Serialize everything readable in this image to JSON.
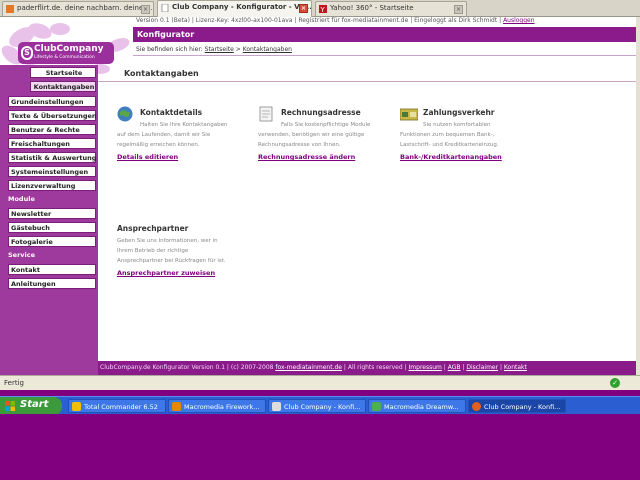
{
  "browser": {
    "tabs": [
      {
        "label": "paderflirt.de. deine nachbarn. deine F...",
        "active": false
      },
      {
        "label": "Club Company - Konfigurator - Ve...",
        "active": true
      },
      {
        "label": "Yahoo! 360° - Startseite",
        "active": false
      }
    ],
    "status_text": "Fertig"
  },
  "header": {
    "meta_text": "Version 0.1 (Beta) | Lizenz-Key: 4xzl00-ax100-01ava | Registriert für fox-mediatainment.de | Eingeloggt als Dirk Schmidt |",
    "logout_label": "Ausloggen",
    "section_title": "Konfigurator",
    "breadcrumb_prefix": "Sie befinden sich hier:",
    "breadcrumb_home": "Startseite",
    "breadcrumb_sep": ">",
    "breadcrumb_current": "Kontaktangaben"
  },
  "logo": {
    "name": "ClubCompany",
    "tagline": "Lifestyle & Communication",
    "mark": "S"
  },
  "sidebar": {
    "top_items": [
      {
        "label": "Startseite"
      },
      {
        "label": "Kontaktangaben"
      }
    ],
    "main_items": [
      {
        "label": "Grundeinstellungen"
      },
      {
        "label": "Texte & Übersetzungen"
      },
      {
        "label": "Benutzer & Rechte"
      },
      {
        "label": "Freischaltungen"
      },
      {
        "label": "Statistik & Auswertung"
      },
      {
        "label": "Systemeinstellungen"
      },
      {
        "label": "Lizenzverwaltung"
      }
    ],
    "module_header": "Module",
    "module_items": [
      {
        "label": "Newsletter"
      },
      {
        "label": "Gästebuch"
      },
      {
        "label": "Fotogalerie"
      }
    ],
    "service_header": "Service",
    "service_items": [
      {
        "label": "Kontakt"
      },
      {
        "label": "Anleitungen"
      }
    ]
  },
  "content": {
    "title": "Kontaktangaben",
    "blocks": [
      {
        "title": "Kontaktdetails",
        "text": "Halten Sie Ihre Kontaktangaben auf dem Laufenden, damit wir Sie regelmäßig erreichen können.",
        "link": "Details editieren"
      },
      {
        "title": "Rechnungsadresse",
        "text": "Falls Sie kostenpflichtige Module verwenden, benötigen wir eine gültige Rechnungsadresse von Ihnen.",
        "link": "Rechnungsadresse ändern"
      },
      {
        "title": "Zahlungsverkehr",
        "text": "Sie nutzen komfortablen Funktionen zum bequemen Bank-, Lastschrift- und Kreditkarteneinzug.",
        "link": "Bank-/Kreditkartenangaben"
      },
      {
        "title": "Ansprechpartner",
        "text": "Geben Sie uns Informationen, wer in Ihrem Betrieb der richtige Ansprechpartner bei Rückfragen für ist.",
        "link": "Ansprechpartner zuweisen"
      }
    ]
  },
  "footer": {
    "text": "ClubCompany.de Konfigurator Version 0.1 | (c) 2007-2008",
    "company_link": "fox-mediatainment.de",
    "rights": "| All rights reserved |",
    "links": [
      "Impressum",
      "AGB",
      "Disclaimer",
      "Kontakt"
    ]
  },
  "taskbar": {
    "start_label": "Start",
    "tasks": [
      {
        "label": "Total Commander 6.52",
        "icon_color": "#f0c000"
      },
      {
        "label": "Macromedia Firework...",
        "icon_color": "#e08a00"
      },
      {
        "label": "Club Company - Konfi...",
        "icon_color": "#dddddd"
      },
      {
        "label": "Macromedia Dreamw...",
        "icon_color": "#4caf50"
      },
      {
        "label": "Club Company - Konfi...",
        "icon_color": "#e06020"
      }
    ]
  },
  "colors": {
    "brand_purple": "#8b1a8b",
    "sidebar_purple": "#9e399e",
    "desktop_purple": "#800080",
    "taskbar_blue": "#2b5ed1"
  }
}
